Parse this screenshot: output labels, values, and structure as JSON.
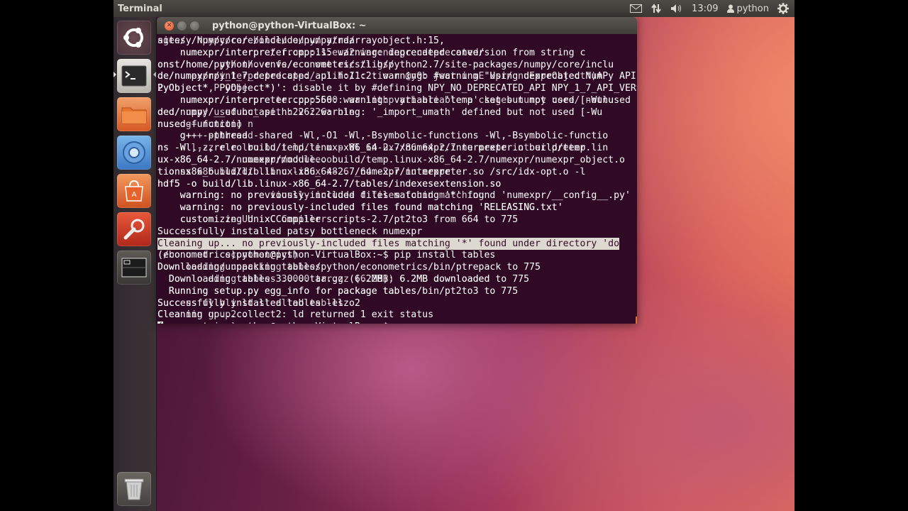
{
  "top_panel": {
    "app_title": "Terminal",
    "clock": "13:09",
    "user": "python",
    "icons": [
      "mail-icon",
      "network-icon",
      "volume-icon",
      "user-icon",
      "gear-icon"
    ]
  },
  "launcher": {
    "items": [
      "ubuntu-dash",
      "terminal",
      "files",
      "chromium",
      "software-center",
      "system-settings",
      "workspace-switcher",
      "trash"
    ]
  },
  "terminal": {
    "title": "python@python-VirtualBox: ~",
    "lines": [
      [
        "sitesy/numpy/core/include/numpy/ndarrayobject.h:15,",
        "ages/  Npy/core/ /bolde/ /oupy/ /atra/"
      ],
      [
        "    numexpr/interpreter.cpp:11: warning: deprecated conversion from string c",
        "    numexpr/interpre/ /frompp:s5e:/2 wareningcendeprecated/"
      ],
      [
        "onst/home/python/.venvs/econometrics/lib/python2.7/site-packages/numpy/core/inclu",
        "onst/ho /e/ /py/ /tho /r /fe/c /u /wettes/ /ti /gs/"
      ],
      [
        "de/numpy/npy_1_7_deprecated_api.h:11:2: warning: #warning \"Using deprecated NumPy API",
        "de/numexpr/interpreted.cpp:/ /ulifo/ /c /tio /n /@y0b /ject /u /mE /xpr/ /nuExprObject*)A"
      ],
      [
        "PyObject*, PyObject*)': disable it by #defining NPY_NO_DEPRECATED_API NPY_1_7_API_VERSION\" [-Wcpp]",
        "2yObject* P /Obje /ct*)':"
      ],
      [
        "    numexpr/interpreter.cpp:560: warning: variable 'temp' set but not used [-Wunused",
        "    numexpr/interpre /ter.cpp:560: /wa /lithp /yth /ariable /a /ckages /numpy /core/ /notlu"
      ],
      [
        "ded/numpy/__ufunc_api.h:226: warning: '_import_umath' defined but not used [-Wu",
        "ded/ /npy/ /used /but /set /h /v /226: /ble"
      ],
      [
        "nused-function]",
        "nusedg+ /functio /n"
      ],
      [
        "    g++ -pthread -shared -Wl,-O1 -Wl,-Bsymbolic-functions -Wl,-Bsymbolic-functio",
        "    g+ /+ -pthread"
      ],
      [
        "ns -Wl,-z,relro build/temp.linux-x86_64-2.7/numexpr/interpreter.o build/temp.lin",
        "ns -W /l,-z /r /e /lro /bu /i /ld/te /m /p /Wl /in /ux-x86 /64 /2.7 /nu /mexpr /int /er /preter"
      ],
      [
        "ux-x86_64-2.7/numexpr/module.o build/temp.linux-x86_64-2.7/numexpr/numexpr_object.o",
        "ux-x86_64-2.7/ /numexpr/module.o"
      ],
      [
        "tionsx86_build/lib.linux-x86_64-2.7/numexpr/interpreter.so /src/idx-opt.o -l",
        "tio /ns /x86 /build/ /lib /c /linux /x8 /6 /_64 /-2.7 /nu /mexpr"
      ],
      [
        "hdf5 -o build/lib.linux-x86_64-2.7/tables/indexesextension.so",
        "hdf5 -o build/lib.linux-x86_64-2.7/tables/indexesextension.so"
      ],
      [
        "    warning: no previously-included files matching '*' found 'numexpr/__config__.py'",
        "    warning: no /pre /viously /include /d /files /found /matching"
      ],
      [
        "    warning: no previously-included files found matching 'RELEASING.txt'",
        "    warning: no previously-included files found matching 'RELEASING.txt'"
      ],
      [
        "    customizing UnixCCompiler scripts-2.7/pt2to3 from 664 to 775",
        "    customi /ze /Un /ixC /Compiler"
      ],
      [
        "Successfully installed patsy bottleneck numexpr",
        ""
      ],
      [
        "Cleaning up... no previously-included files matching '*' found under directory 'do",
        ""
      ],
      [
        "(econometrics)python@python-VirtualBox:~$ pip install tables",
        "(/bo /u /nd /  /econometrics)"
      ],
      [
        "Downloading/unpacking tables/python/econometrics/bin/ptrepack to 775",
        "Down /loading /unpacking /tables"
      ],
      [
        "  Downloading tables-3.0.0.tar.gz (6.2MB): 6.2MB downloaded to 775",
        "  Downlo /ading /tables /3.0.0 /tar.gz /(6.2MB) /6.2MB /downloaded"
      ],
      [
        "  Running setup.py egg_info for package tables/bin/pt2to3 to 775",
        "  Running /setup.py /egg_info /for /package /tables"
      ],
      [
        "Successfully installed tables -llzo2",
        "Succ /us /fy /bly /ld /st /alled /tables"
      ],
      [
        "Cleaning up...collect2: ld returned 1 exit status",
        "Clea /nin /g /up2 /."
      ],
      [
        "(econometrics)python@python-VirtualBox:~$ ",
        ""
      ]
    ]
  }
}
